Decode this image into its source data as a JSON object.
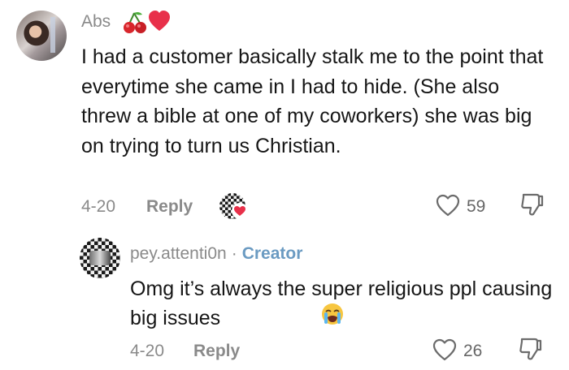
{
  "comment": {
    "username": "Abs",
    "username_emojis": [
      "cherries-emoji",
      "red-heart-emoji"
    ],
    "text": "I had a customer basically stalk me to the point that everytime she came in I had to hide. (She also threw a bible at one of my coworkers) she was big on trying to turn us Christian.",
    "date": "4-20",
    "reply_label": "Reply",
    "like_count": "59"
  },
  "reply": {
    "username": "pey.attenti0n",
    "separator": "·",
    "badge": "Creator",
    "text": "Omg it’s always the super religious ppl causing big issues",
    "text_emoji": "loudly-crying-face-emoji",
    "date": "4-20",
    "reply_label": "Reply",
    "like_count": "26"
  },
  "colors": {
    "text": "#161616",
    "muted": "#8a8a8a",
    "creator_badge": "#6b9bc2",
    "heart": "#e8304a"
  }
}
